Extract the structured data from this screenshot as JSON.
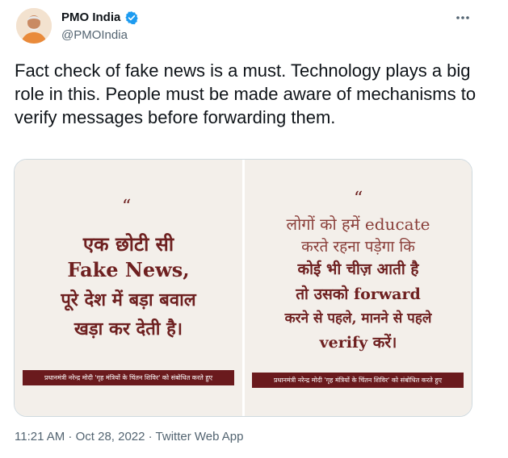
{
  "author": {
    "name": "PMO India",
    "handle": "@PMOIndia"
  },
  "tweet": {
    "text": "Fact check of fake news is a must. Technology plays a big role in this. People must be made aware of mechanisms to verify messages before forwarding them.",
    "timestamp": "11:21 AM · Oct 28, 2022",
    "source": "Twitter Web App",
    "separator": " · "
  },
  "media": {
    "left_card": {
      "quote": "“",
      "lines": [
        "एक छोटी सी",
        "Fake News,",
        "पूरे देश में बड़ा बवाल",
        "खड़ा कर देती है।"
      ],
      "banner": "प्रधानमंत्री नरेन्द्र मोदी 'गृह मंत्रियों के चिंतन शिविर' को संबोधित करते हुए"
    },
    "right_card": {
      "quote": "“",
      "lines": [
        "लोगों को हमें educate",
        "करते रहना पड़ेगा कि",
        "कोई भी चीज़ आती है",
        "तो उसको forward",
        "करने से पहले, मानने से पहले",
        "verify करें।"
      ],
      "banner": "प्रधानमंत्री नरेन्द्र मोदी 'गृह मंत्रियों के चिंतन शिविर' को संबोधित करते हुए"
    }
  },
  "colors": {
    "verified_badge": "#1d9bf0",
    "card_text": "#6e2020",
    "card_background": "#f3efea",
    "banner_background": "#6a1a1d",
    "secondary_text": "#536471"
  },
  "icons": {
    "verified": "verified-badge-icon",
    "more": "more-options-icon"
  }
}
